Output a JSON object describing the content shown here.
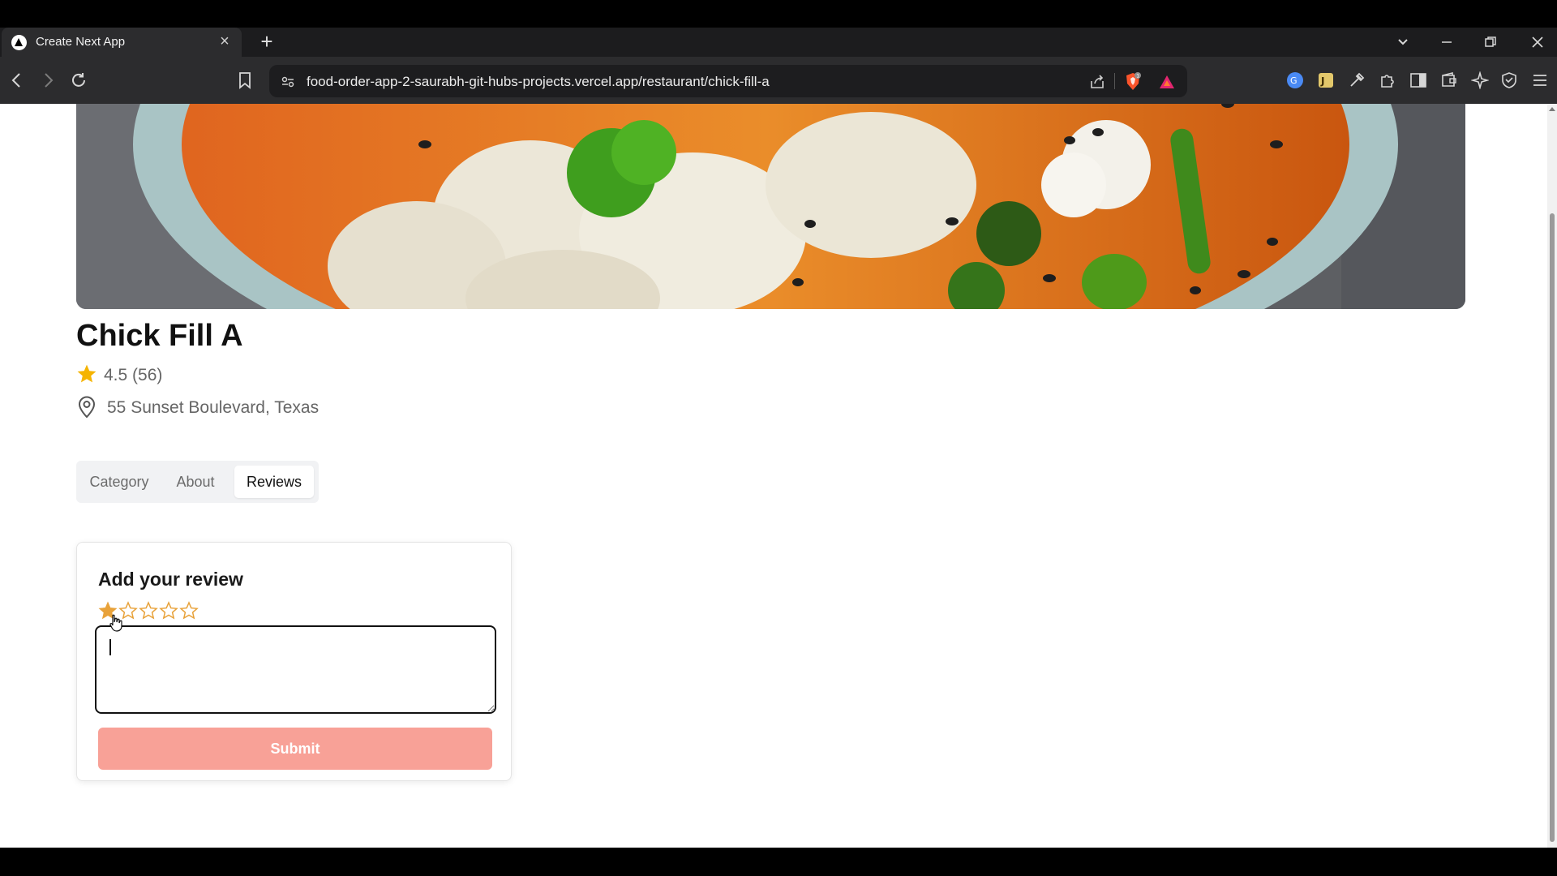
{
  "browser": {
    "tab_title": "Create Next App",
    "tab_close_glyph": "×",
    "new_tab_glyph": "+",
    "url": "food-order-app-2-saurabh-git-hubs-projects.vercel.app/restaurant/chick-fill-a"
  },
  "restaurant": {
    "name": "Chick Fill A",
    "rating": "4.5 (56)",
    "address": "55 Sunset Boulevard, Texas",
    "star_color": "#f5b400"
  },
  "tabs": [
    {
      "label": "Category",
      "active": false
    },
    {
      "label": "About",
      "active": false
    },
    {
      "label": "Reviews",
      "active": true
    }
  ],
  "review": {
    "heading": "Add your review",
    "stars_total": 5,
    "stars_filled": 1,
    "text_value": "",
    "submit_label": "Submit",
    "submit_color": "#f8a197",
    "star_color": "#e8a23a"
  },
  "icons": {
    "back": "arrow-left-icon",
    "forward": "arrow-right-icon",
    "reload": "reload-icon",
    "bookmark": "bookmark-icon",
    "site_info": "site-settings-icon",
    "share": "share-icon",
    "shields": "brave-shields-icon",
    "rewards": "brave-rewards-icon"
  }
}
